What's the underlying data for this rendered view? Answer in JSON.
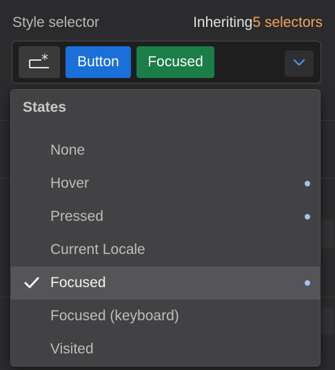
{
  "header": {
    "label": "Style selector",
    "inheriting_prefix": "Inheriting",
    "inheriting_count": "5 selectors"
  },
  "selector": {
    "icon": "selector-new-icon",
    "pills": [
      {
        "label": "Button",
        "color": "#1a6fd9"
      },
      {
        "label": "Focused",
        "color": "#1b7d48"
      }
    ],
    "dropdown_icon": "chevron-down-icon"
  },
  "states_menu": {
    "title": "States",
    "items": [
      {
        "label": "None",
        "selected": false,
        "has_dot": false
      },
      {
        "label": "Hover",
        "selected": false,
        "has_dot": true
      },
      {
        "label": "Pressed",
        "selected": false,
        "has_dot": true
      },
      {
        "label": "Current Locale",
        "selected": false,
        "has_dot": false
      },
      {
        "label": "Focused",
        "selected": true,
        "has_dot": true
      },
      {
        "label": "Focused (keyboard)",
        "selected": false,
        "has_dot": false
      },
      {
        "label": "Visited",
        "selected": false,
        "has_dot": false
      }
    ],
    "dot_color": "#9cc7f5"
  }
}
